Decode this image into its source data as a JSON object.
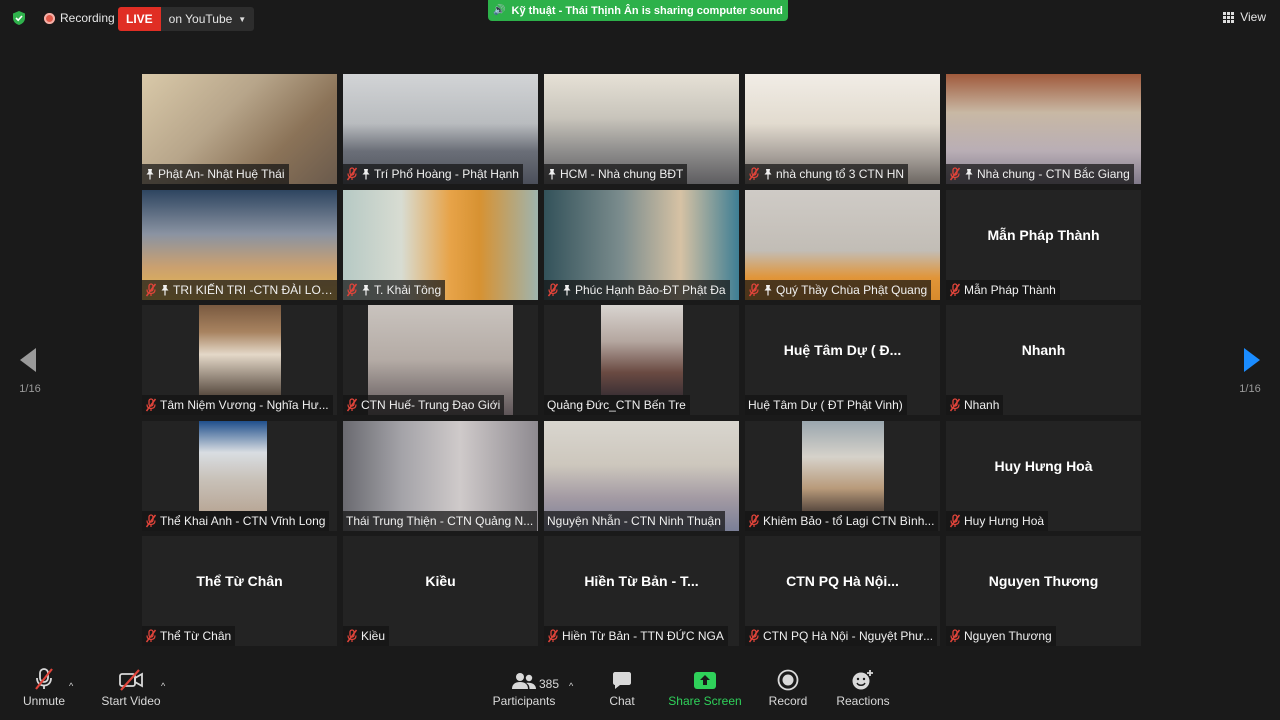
{
  "topbar": {
    "recording_label": "Recording",
    "live_label": "LIVE",
    "platform_label": "on YouTube",
    "share_banner": "Kỹ thuật - Thái Thịnh Ân is sharing computer sound",
    "view_label": "View"
  },
  "pager": {
    "left_page": "1/16",
    "right_page": "1/16"
  },
  "tiles": [
    {
      "name": "Phật An- Nhật Huệ Thái",
      "display": "",
      "video": true,
      "muted": false,
      "pinned": true
    },
    {
      "name": "Trí Phổ Hoàng - Phật Hạnh",
      "display": "",
      "video": true,
      "muted": true,
      "pinned": true
    },
    {
      "name": "HCM - Nhà chung BĐT",
      "display": "",
      "video": true,
      "muted": false,
      "pinned": true
    },
    {
      "name": "nhà chung tổ 3 CTN HN",
      "display": "",
      "video": true,
      "muted": true,
      "pinned": true
    },
    {
      "name": "Nhà chung - CTN Bắc Giang",
      "display": "",
      "video": true,
      "muted": true,
      "pinned": true
    },
    {
      "name": "TRI KIẾN TRI -CTN ĐÀI LOAN",
      "display": "",
      "video": true,
      "muted": true,
      "pinned": true
    },
    {
      "name": "T. Khải Tông",
      "display": "",
      "video": true,
      "muted": true,
      "pinned": true
    },
    {
      "name": "Phúc Hạnh Bảo-ĐT Phật Đa",
      "display": "",
      "video": true,
      "muted": true,
      "pinned": true
    },
    {
      "name": "Quý Thầy Chùa Phật Quang",
      "display": "",
      "video": true,
      "muted": true,
      "pinned": true
    },
    {
      "name": "Mẫn Pháp Thành",
      "display": "Mẫn Pháp Thành",
      "video": false,
      "muted": true,
      "pinned": false
    },
    {
      "name": "Tâm Niệm Vương - Nghĩa Hư...",
      "display": "",
      "video": true,
      "muted": true,
      "pinned": false
    },
    {
      "name": "CTN Huế- Trung Đạo Giới",
      "display": "",
      "video": true,
      "muted": true,
      "pinned": false
    },
    {
      "name": "Quảng Đức_CTN Bến Tre",
      "display": "",
      "video": true,
      "muted": false,
      "pinned": false
    },
    {
      "name": "Huệ Tâm Dự ( ĐT Phật Vinh)",
      "display": "Huệ Tâm Dự ( Đ...",
      "video": false,
      "muted": false,
      "pinned": false
    },
    {
      "name": "Nhanh",
      "display": "Nhanh",
      "video": false,
      "muted": true,
      "pinned": false
    },
    {
      "name": "Thể Khai Anh - CTN Vĩnh Long",
      "display": "",
      "video": true,
      "muted": true,
      "pinned": false
    },
    {
      "name": "Thái Trung Thiện - CTN Quảng N...",
      "display": "",
      "video": true,
      "muted": false,
      "pinned": false
    },
    {
      "name": "Nguyện Nhẫn - CTN Ninh Thuận",
      "display": "",
      "video": true,
      "muted": false,
      "pinned": false
    },
    {
      "name": "Khiêm Bảo - tổ Lagi CTN Bình...",
      "display": "",
      "video": true,
      "muted": true,
      "pinned": false
    },
    {
      "name": "Huy Hưng Hoà",
      "display": "Huy Hưng Hoà",
      "video": false,
      "muted": true,
      "pinned": false
    },
    {
      "name": "Thể Từ Chân",
      "display": "Thể Từ Chân",
      "video": false,
      "muted": true,
      "pinned": false
    },
    {
      "name": "Kiều",
      "display": "Kiều",
      "video": false,
      "muted": true,
      "pinned": false
    },
    {
      "name": "Hiền Từ Bản - TTN ĐỨC NGA",
      "display": "Hiền Từ Bản - T...",
      "video": false,
      "muted": true,
      "pinned": false
    },
    {
      "name": "CTN PQ Hà Nội - Nguyệt Phư...",
      "display": "CTN PQ Hà Nội...",
      "video": false,
      "muted": true,
      "pinned": false
    },
    {
      "name": "Nguyen Thương",
      "display": "Nguyen Thương",
      "video": false,
      "muted": true,
      "pinned": false
    }
  ],
  "toolbar": {
    "unmute": "Unmute",
    "start_video": "Start Video",
    "participants": "Participants",
    "participants_count": "385",
    "chat": "Chat",
    "share_screen": "Share Screen",
    "record": "Record",
    "reactions": "Reactions"
  },
  "colors": {
    "live": "#e02e24",
    "share_banner": "#2db14a",
    "share_screen_label": "#2fd15a",
    "next_arrow": "#1a8cff",
    "mute_icon": "#e0443a"
  }
}
